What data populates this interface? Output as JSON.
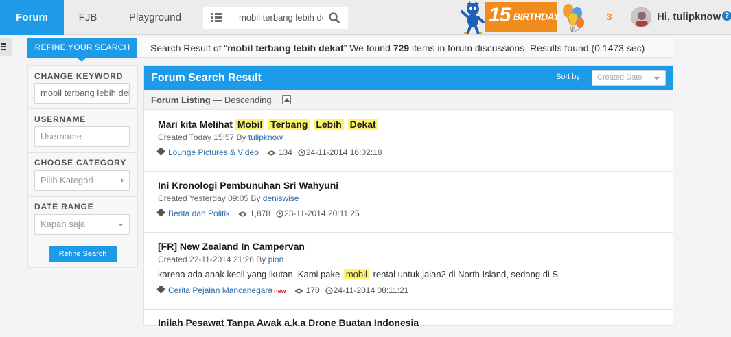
{
  "nav": {
    "tabs": [
      "Forum",
      "FJB",
      "Playground"
    ],
    "search_value": "mobil terbang lebih dekat",
    "birthday_number": "15",
    "birthday_text": "BIRTHDAY",
    "notification_count": "3",
    "greeting": "Hi, tulipknow",
    "help": "?"
  },
  "refine": {
    "tab_label": "REFINE YOUR SEARCH",
    "result_prefix": "Search Result of “",
    "query": "mobil terbang lebih dekat",
    "result_mid": "” We found ",
    "count": "729",
    "result_suffix": " items in forum discussions. Results found (0.1473 sec)"
  },
  "sidebar": {
    "keyword_label": "CHANGE KEYWORD",
    "keyword_value": "mobil terbang lebih dekat",
    "username_label": "USERNAME",
    "username_placeholder": "Username",
    "category_label": "CHOOSE CATEGORY",
    "category_placeholder": "Pilih Kategori",
    "date_label": "DATE RANGE",
    "date_value": "Kapan saja",
    "button": "Refine Search"
  },
  "results": {
    "title": "Forum Search Result",
    "sort_label": "Sort by :",
    "sort_value": "Created Date",
    "listing_label": "Forum Listing",
    "listing_order": " — Descending",
    "items": [
      {
        "title_plain": "Mari kita Melihat ",
        "title_hl": [
          "Mobil",
          "Terbang",
          "Lebih",
          "Dekat"
        ],
        "created": "Created Today 15:57 By ",
        "author": "tulipknow",
        "category": "Lounge Pictures & Video",
        "views": "134",
        "date": "24-11-2014 16:02:18"
      },
      {
        "title_plain": "Ini Kronologi Pembunuhan Sri Wahyuni",
        "created": "Created Yesterday 09:05 By ",
        "author": "deniswise",
        "category": "Berita dan Politik",
        "views": "1,878",
        "date": "23-11-2014 20:11:25"
      },
      {
        "title_plain": "[FR] New Zealand In Campervan",
        "created": "Created 22-11-2014 21:26 By ",
        "author": "pion",
        "excerpt_pre": "karena ada anak kecil yang ikutan. Kami pake ",
        "excerpt_hl": "mobil",
        "excerpt_post": " rental untuk jalan2 di North Island, sedang di S",
        "category": "Cerita Pejalan Mancanegara",
        "badge": "new",
        "views": "170",
        "date": "24-11-2014 08:11:21"
      },
      {
        "title_plain": "Inilah Pesawat Tanpa Awak a.k.a Drone Buatan Indonesia"
      }
    ]
  }
}
